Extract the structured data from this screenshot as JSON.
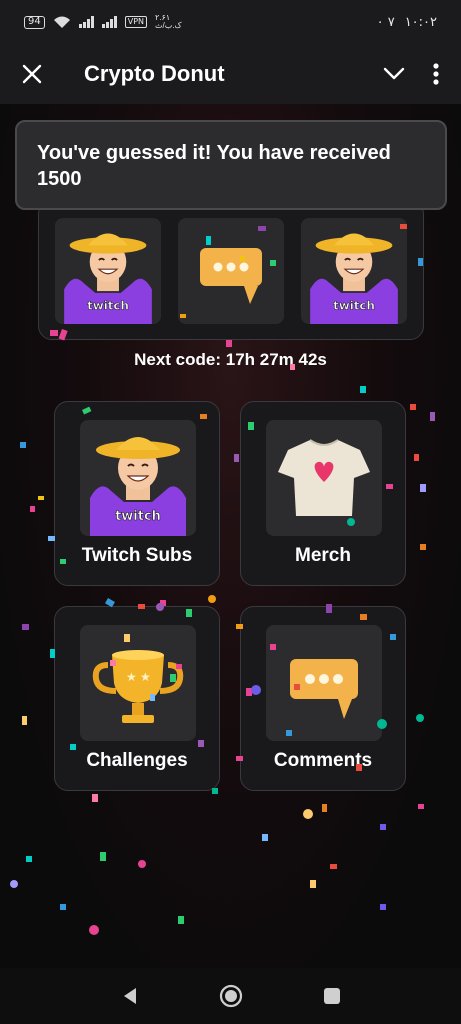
{
  "status_bar": {
    "battery": "94",
    "vpn": "VPN",
    "data_rate": "۲.۶۱",
    "data_unit": "ک.ب/ث",
    "right_text": "۰ ۷",
    "time": "۱۰:۰۲"
  },
  "app_bar": {
    "title": "Crypto Donut",
    "close_icon": "close-icon",
    "chevron_icon": "chevron-down-icon",
    "more_icon": "more-vertical-icon"
  },
  "toast": {
    "message": "You've guessed it! You have received 1500"
  },
  "code_tiles": [
    "streamer-avatar",
    "comment-bubble",
    "streamer-avatar"
  ],
  "next_code": "Next code: 17h 27m 42s",
  "cards": [
    {
      "label": "Twitch Subs",
      "icon": "streamer-avatar"
    },
    {
      "label": "Merch",
      "icon": "tshirt-icon"
    },
    {
      "label": "Challenges",
      "icon": "trophy-icon"
    },
    {
      "label": "Comments",
      "icon": "comment-bubble-icon"
    }
  ],
  "streamer_badge": "twitch",
  "nav_bar": [
    "back-icon",
    "home-icon",
    "recents-icon"
  ]
}
